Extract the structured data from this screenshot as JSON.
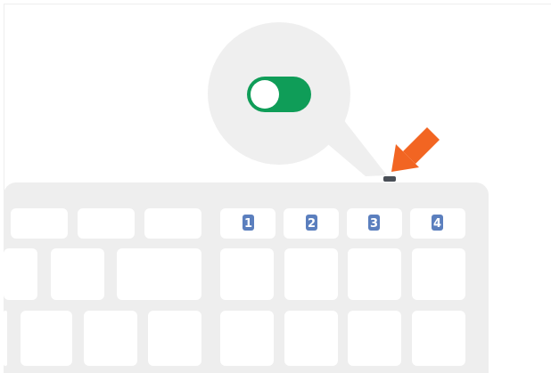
{
  "colors": {
    "keyboard_body": "#eeeeee",
    "key": "#ffffff",
    "callout": "#efefef",
    "toggle_on": "#0f9d58",
    "arrow": "#f26522",
    "led": "#4a4f57",
    "number_badge": "#5b7fbe"
  },
  "callout": {
    "icon": "toggle-switch-on-icon",
    "state": "on"
  },
  "indicator": {
    "icon": "arrow-pointing-down-left-icon"
  },
  "keyboard": {
    "number_keys": [
      "1",
      "2",
      "3",
      "4"
    ]
  }
}
